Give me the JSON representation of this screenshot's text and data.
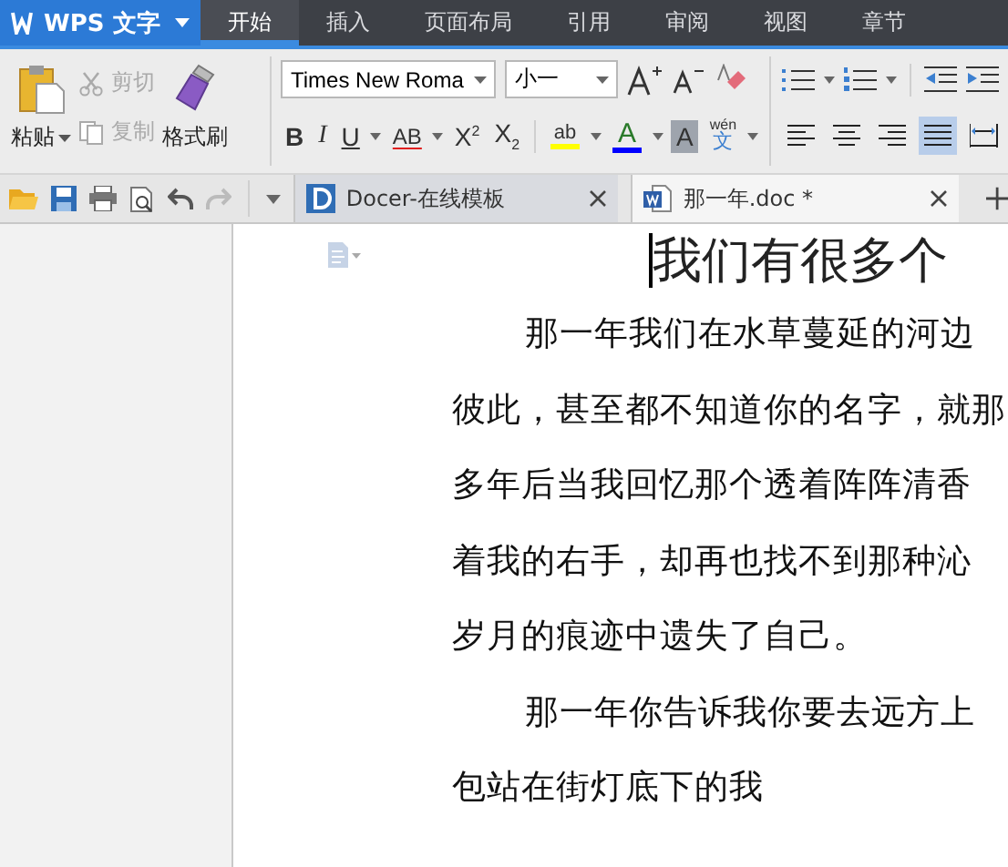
{
  "app_menu": {
    "label": "WPS 文字"
  },
  "ribbon_tabs": [
    {
      "label": "开始",
      "selected": true
    },
    {
      "label": "插入",
      "selected": false
    },
    {
      "label": "页面布局",
      "selected": false
    },
    {
      "label": "引用",
      "selected": false
    },
    {
      "label": "审阅",
      "selected": false
    },
    {
      "label": "视图",
      "selected": false
    },
    {
      "label": "章节",
      "selected": false
    }
  ],
  "clipboard": {
    "paste": "粘贴",
    "cut": {
      "label": "剪切",
      "disabled": true
    },
    "copy": {
      "label": "复制",
      "disabled": true
    },
    "format_painter": "格式刷"
  },
  "font": {
    "family": "Times New Roma",
    "size": "小一",
    "format_buttons": [
      {
        "kind": "bold",
        "label": "B"
      },
      {
        "kind": "italic",
        "label": "I"
      },
      {
        "kind": "underline",
        "label": "U"
      },
      {
        "kind": "strike",
        "label": "AB"
      },
      {
        "kind": "superscript",
        "label": "X",
        "mark": "2"
      },
      {
        "kind": "subscript",
        "label": "X",
        "mark": "2"
      }
    ],
    "highlight": {
      "label": "ab",
      "color": "#ffff00"
    },
    "font_color": {
      "label": "A",
      "color": "#0000ff"
    },
    "shading": {
      "label": "A"
    },
    "phonetic": {
      "top": "wén",
      "bottom": "文"
    }
  },
  "alignment": [
    {
      "kind": "left",
      "selected": false
    },
    {
      "kind": "center",
      "selected": false
    },
    {
      "kind": "right",
      "selected": false
    },
    {
      "kind": "justify",
      "selected": true
    },
    {
      "kind": "distributed",
      "selected": false
    }
  ],
  "quick_access": {
    "redo": {
      "disabled": true
    }
  },
  "document_tabs": [
    {
      "kind": "docer",
      "title": "Docer-在线模板",
      "selected": false
    },
    {
      "kind": "word",
      "title": "那一年.doc *",
      "selected": true
    }
  ],
  "document": {
    "heading": "我们有很多个",
    "lines": [
      {
        "text": "那一年我们在水草蔓延的河边",
        "indent": true
      },
      {
        "text": "彼此，甚至都不知道你的名字，就那",
        "indent": false
      },
      {
        "text": "多年后当我回忆那个透着阵阵清香",
        "indent": false
      },
      {
        "text": "着我的右手，却再也找不到那种沁",
        "indent": false
      },
      {
        "text": "岁月的痕迹中遗失了自己。",
        "indent": false
      },
      {
        "text": "那一年你告诉我你要去远方上",
        "indent": true
      },
      {
        "text": "包站在街灯底下的我",
        "indent": false
      }
    ]
  }
}
